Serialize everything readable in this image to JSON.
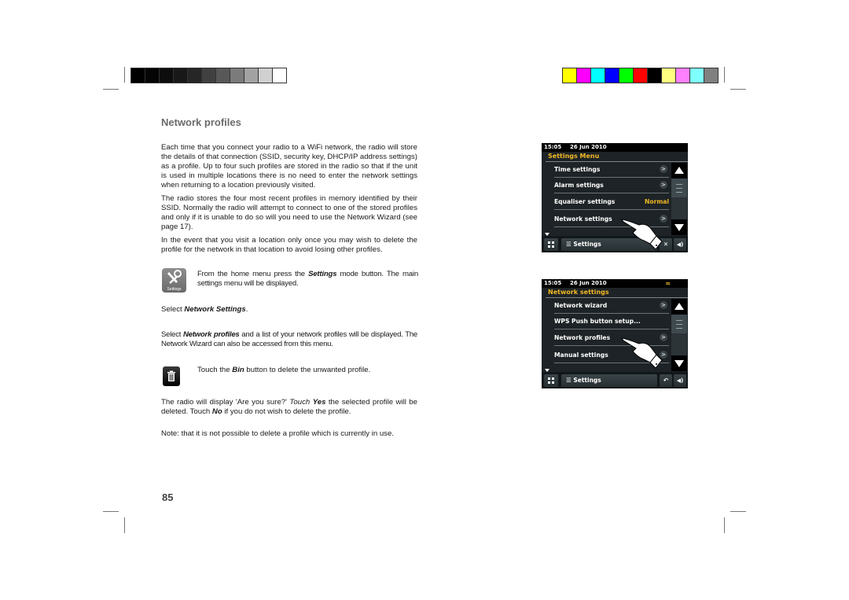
{
  "colors": {
    "grayscale_bar": [
      "#000000",
      "#050505",
      "#0d0d0d",
      "#181818",
      "#262626",
      "#404040",
      "#585858",
      "#7b7b7b",
      "#a2a2a2",
      "#d0d0d0",
      "#ffffff"
    ],
    "color_bar": [
      "#ffff00",
      "#ff00ff",
      "#00ffff",
      "#0000ff",
      "#00ff00",
      "#ff0000",
      "#000000",
      "#ffff80",
      "#ff80ff",
      "#80ffff",
      "#808080"
    ],
    "accent": "#f1b826"
  },
  "page": {
    "heading": "Network profiles",
    "paragraphs": [
      "Each time that you connect your radio to a WiFi network, the radio will store the details of that connection (SSID, security key, DHCP/IP address settings) as a profile. Up to four such profiles are stored in the radio so that if the unit is used in multiple locations there is no need to enter the network settings when returning to a location previously visited.",
      "The radio stores the four most recent profiles in memory identified by their SSID. Normally the radio will attempt to connect to one of the stored profiles and only if it is unable to do so will you need to use the Network Wizard (see page 17).",
      "In the event that you visit a location only once you may wish to delete the profile for the network in that location to avoid losing other profiles."
    ],
    "step1": {
      "pre": "From the home menu press the ",
      "em": "Settings",
      "post": " mode button. The main settings menu will be displayed.",
      "icon": "settings-icon",
      "icon_label": "Settings"
    },
    "step2": {
      "pre": "Select ",
      "em": "Network Settings",
      "post": "."
    },
    "step3": {
      "pre": "Select ",
      "em": "Network profiles",
      "post": " and a list of your network profiles will be displayed. The Network Wizard can also be accessed from this menu."
    },
    "step4": {
      "pre": "Touch the ",
      "em": "Bin",
      "post": " button to delete the unwanted profile.",
      "icon": "bin-icon"
    },
    "step5": {
      "a": "The radio will display 'Are you sure?' ",
      "b": "Touch",
      "c": " ",
      "d": "Yes",
      "e": " the selected profile will be deleted. Touch ",
      "f": "No",
      "g": " if you do not wish to delete the profile."
    },
    "note": "Note: that it is not possible to delete a profile which is currently in use.",
    "page_number": "85"
  },
  "screens": [
    {
      "time": "15:05",
      "date": "26 Jun 2010",
      "wifi": false,
      "title": "Settings Menu",
      "items": [
        {
          "label": "Time settings",
          "value": null
        },
        {
          "label": "Alarm settings",
          "value": null
        },
        {
          "label": "Equaliser settings",
          "value": "Normal"
        },
        {
          "label": "Network settings",
          "value": null
        }
      ],
      "bottom_label": "Settings",
      "back_button": "close"
    },
    {
      "time": "15:05",
      "date": "26 Jun 2010",
      "wifi": true,
      "title": "Network settings",
      "items": [
        {
          "label": "Network wizard",
          "value": null
        },
        {
          "label": "WPS Push button setup...",
          "value": null
        },
        {
          "label": "Network profiles",
          "value": null
        },
        {
          "label": "Manual settings",
          "value": null
        }
      ],
      "bottom_label": "Settings",
      "back_button": "back"
    }
  ]
}
